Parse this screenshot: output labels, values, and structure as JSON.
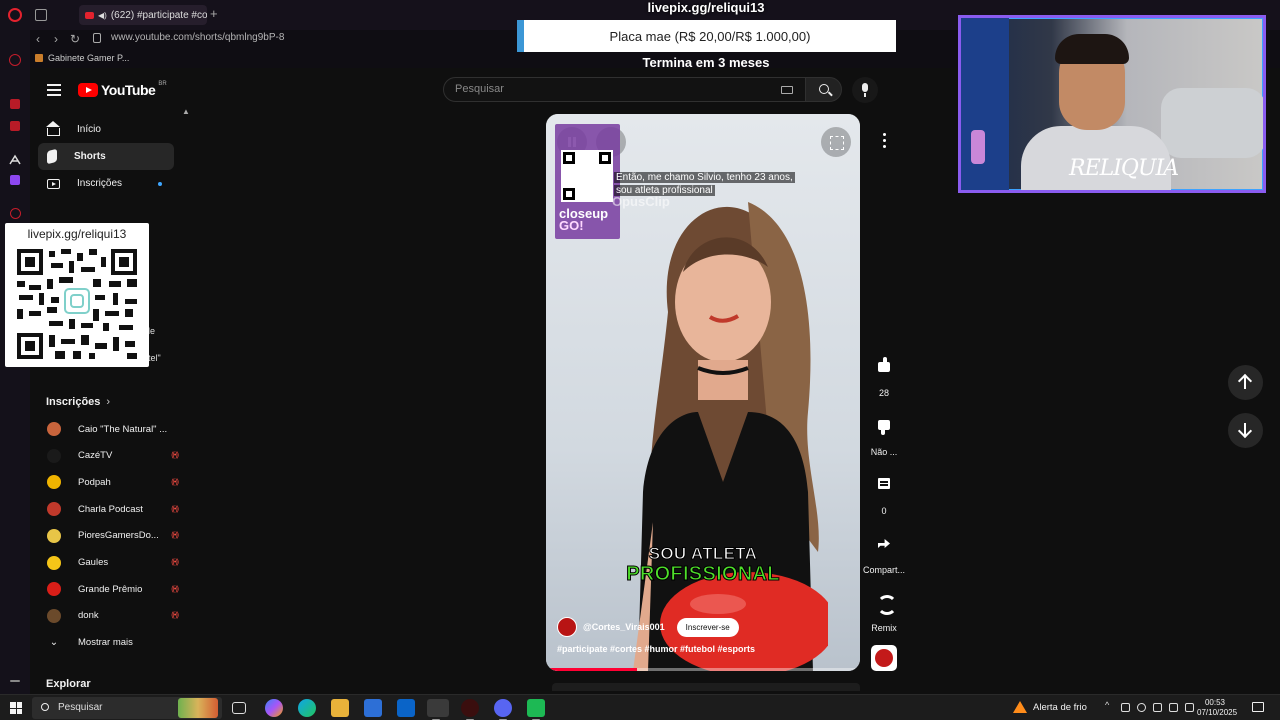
{
  "browser": {
    "tab_title": "(622) #participate #co",
    "url": "www.youtube.com/shorts/qbmlng9bP-8",
    "bookmark": "Gabinete Gamer P..."
  },
  "youtube": {
    "logo_text": "YouTube",
    "country_code": "BR",
    "search_placeholder": "Pesquisar"
  },
  "sidebar": {
    "items": [
      {
        "label": "Início",
        "icon": "home-icon"
      },
      {
        "label": "Shorts",
        "icon": "shorts-icon"
      },
      {
        "label": "Inscrições",
        "icon": "subscriptions-icon"
      }
    ],
    "partial_texts": [
      "le",
      "tel\""
    ],
    "subscriptions_title": "Inscrições",
    "subscriptions": [
      {
        "name": "Caio \"The Natural\" ...",
        "live": false,
        "color": "#c8643c"
      },
      {
        "name": "CazéTV",
        "live": true,
        "color": "#1a1a1a"
      },
      {
        "name": "Podpah",
        "live": true,
        "color": "#f0b400"
      },
      {
        "name": "Charla Podcast",
        "live": true,
        "color": "#c0392b"
      },
      {
        "name": "PioresGamersDo...",
        "live": true,
        "color": "#e8c547"
      },
      {
        "name": "Gaules",
        "live": true,
        "color": "#f5c518"
      },
      {
        "name": "Grande Prêmio",
        "live": true,
        "color": "#d91e18"
      },
      {
        "name": "donk",
        "live": true,
        "color": "#6b4a2b"
      }
    ],
    "show_more": "Mostrar mais",
    "explore_title": "Explorar"
  },
  "stream_overlay": {
    "title": "livepix.gg/reliqui13",
    "goal": "Placa mae (R$ 20,00/R$ 1.000,00)",
    "goal_sub": "Termina em 3 meses",
    "qr_title": "livepix.gg/reliqui13",
    "webcam_brand": "RELIQUIA",
    "colors": {
      "webcam_border": "#8a5cf0",
      "goal_accent": "#3c97d6"
    }
  },
  "short": {
    "caption": [
      "Então, me chamo Silvio, tenho 23 anos,",
      "sou atleta profissional"
    ],
    "watermark": "OpusClip",
    "mini_brand": [
      "closeup",
      "GO!"
    ],
    "burned_text_1": "SOU ATLETA",
    "burned_text_2": "PROFISSIONAL",
    "channel": "@Cortes_Virais001",
    "subscribe": "Inscrever-se",
    "hashtags": "#participate #cortes #humor #futebol #esports",
    "progress": 0.29,
    "colors": {
      "progress": "#ff0033",
      "highlight": "#4ee02a"
    }
  },
  "actions": {
    "like_count": "28",
    "dislike_label": "Não ...",
    "comment_count": "0",
    "share_label": "Compart...",
    "remix_label": "Remix"
  },
  "taskbar": {
    "search_placeholder": "Pesquisar",
    "weather": "Alerta de frio",
    "time": "00:53",
    "date": "07/10/2025"
  }
}
